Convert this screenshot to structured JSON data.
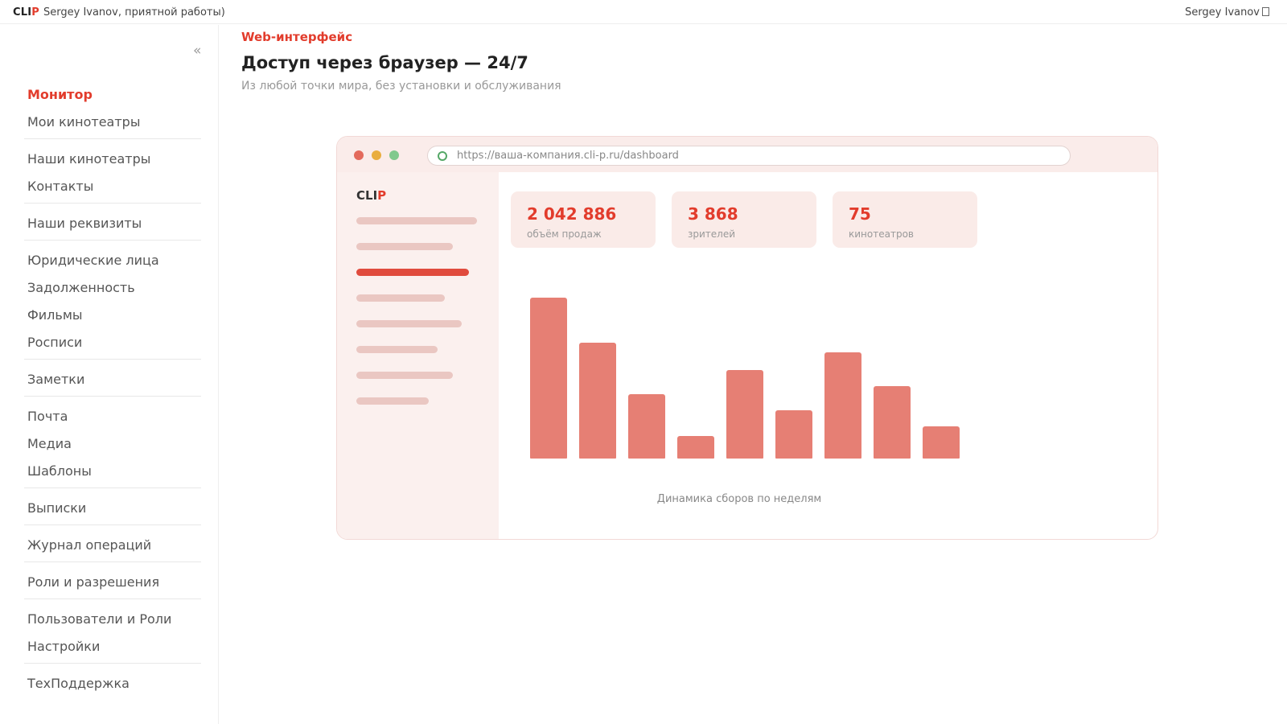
{
  "topbar": {
    "brand_main": "CLI",
    "brand_accent": "P",
    "greeting": "Sergey Ivanov, приятной работы)",
    "user_name": "Sergey Ivanov"
  },
  "sidebar": {
    "collapse_label": "«",
    "groups": [
      [
        "Монитор",
        "Мои кинотеатры"
      ],
      [
        "Наши кинотеатры",
        "Контакты"
      ],
      [
        "Наши реквизиты"
      ],
      [
        "Юридические лица",
        "Задолженность",
        "Фильмы",
        "Росписи"
      ],
      [
        "Заметки"
      ],
      [
        "Почта",
        "Медиа",
        "Шаблоны"
      ],
      [
        "Выписки"
      ],
      [
        "Журнал операций"
      ],
      [
        "Роли и разрешения"
      ],
      [
        "Пользователи и Роли",
        "Настройки"
      ],
      [
        "ТехПоддержка"
      ]
    ],
    "active": "Монитор"
  },
  "hero": {
    "eyebrow": "Web-интерфейс",
    "title": "Доступ через браузер — 24/7",
    "subtitle": "Из любой точки мира, без установки и обслуживания"
  },
  "browser_mock": {
    "url": "https://ваша-компания.cli-p.ru/dashboard",
    "brand_main": "CLI",
    "brand_accent": "P",
    "stats": [
      {
        "value": "2 042 886",
        "label": "объём продаж"
      },
      {
        "value": "3 868",
        "label": "зрителей"
      },
      {
        "value": "75",
        "label": "кинотеатров"
      }
    ],
    "menu_line_fractions": [
      1.0,
      0.8,
      0.93,
      0.73,
      0.87,
      0.67,
      0.8,
      0.6
    ],
    "active_menu_line": 2
  },
  "chart_data": {
    "type": "bar",
    "title": "Динамика сборов по неделям",
    "categories": [
      "",
      "",
      "",
      "",
      "",
      "",
      "",
      "",
      ""
    ],
    "values": [
      100,
      72,
      40,
      14,
      55,
      30,
      66,
      45,
      20
    ],
    "ylim": [
      0,
      100
    ],
    "color": "#e67f74"
  },
  "colors": {
    "accent": "#e23c2c",
    "bar": "#e67f74",
    "panel": "#faecea"
  }
}
